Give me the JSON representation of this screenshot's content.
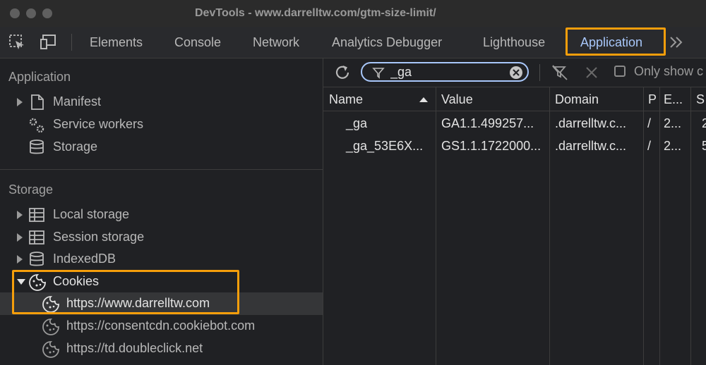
{
  "window": {
    "title": "DevTools - www.darrelltw.com/gtm-size-limit/"
  },
  "tabs": [
    "Elements",
    "Console",
    "Network",
    "Analytics Debugger",
    "Lighthouse",
    "Application"
  ],
  "active_tab": "Application",
  "sidebar": {
    "application_header": "Application",
    "application_items": [
      "Manifest",
      "Service workers",
      "Storage"
    ],
    "storage_header": "Storage",
    "storage_items": [
      "Local storage",
      "Session storage",
      "IndexedDB",
      "Cookies"
    ],
    "cookie_origins": [
      "https://www.darrelltw.com",
      "https://consentcdn.cookiebot.com",
      "https://td.doubleclick.net"
    ]
  },
  "filter": {
    "value": "_ga"
  },
  "only_show_label": "Only show c",
  "table": {
    "columns": [
      "Name",
      "Value",
      "Domain",
      "P",
      "E...",
      "S"
    ],
    "rows": [
      [
        "_ga",
        "GA1.1.499257...",
        ".darrelltw.c...",
        "/",
        "2...",
        "2"
      ],
      [
        "_ga_53E6X...",
        "GS1.1.1722000...",
        ".darrelltw.c...",
        "/",
        "2...",
        "5"
      ]
    ]
  },
  "colors": {
    "accent": "#a8c7fa",
    "highlight": "#f59e0b"
  }
}
